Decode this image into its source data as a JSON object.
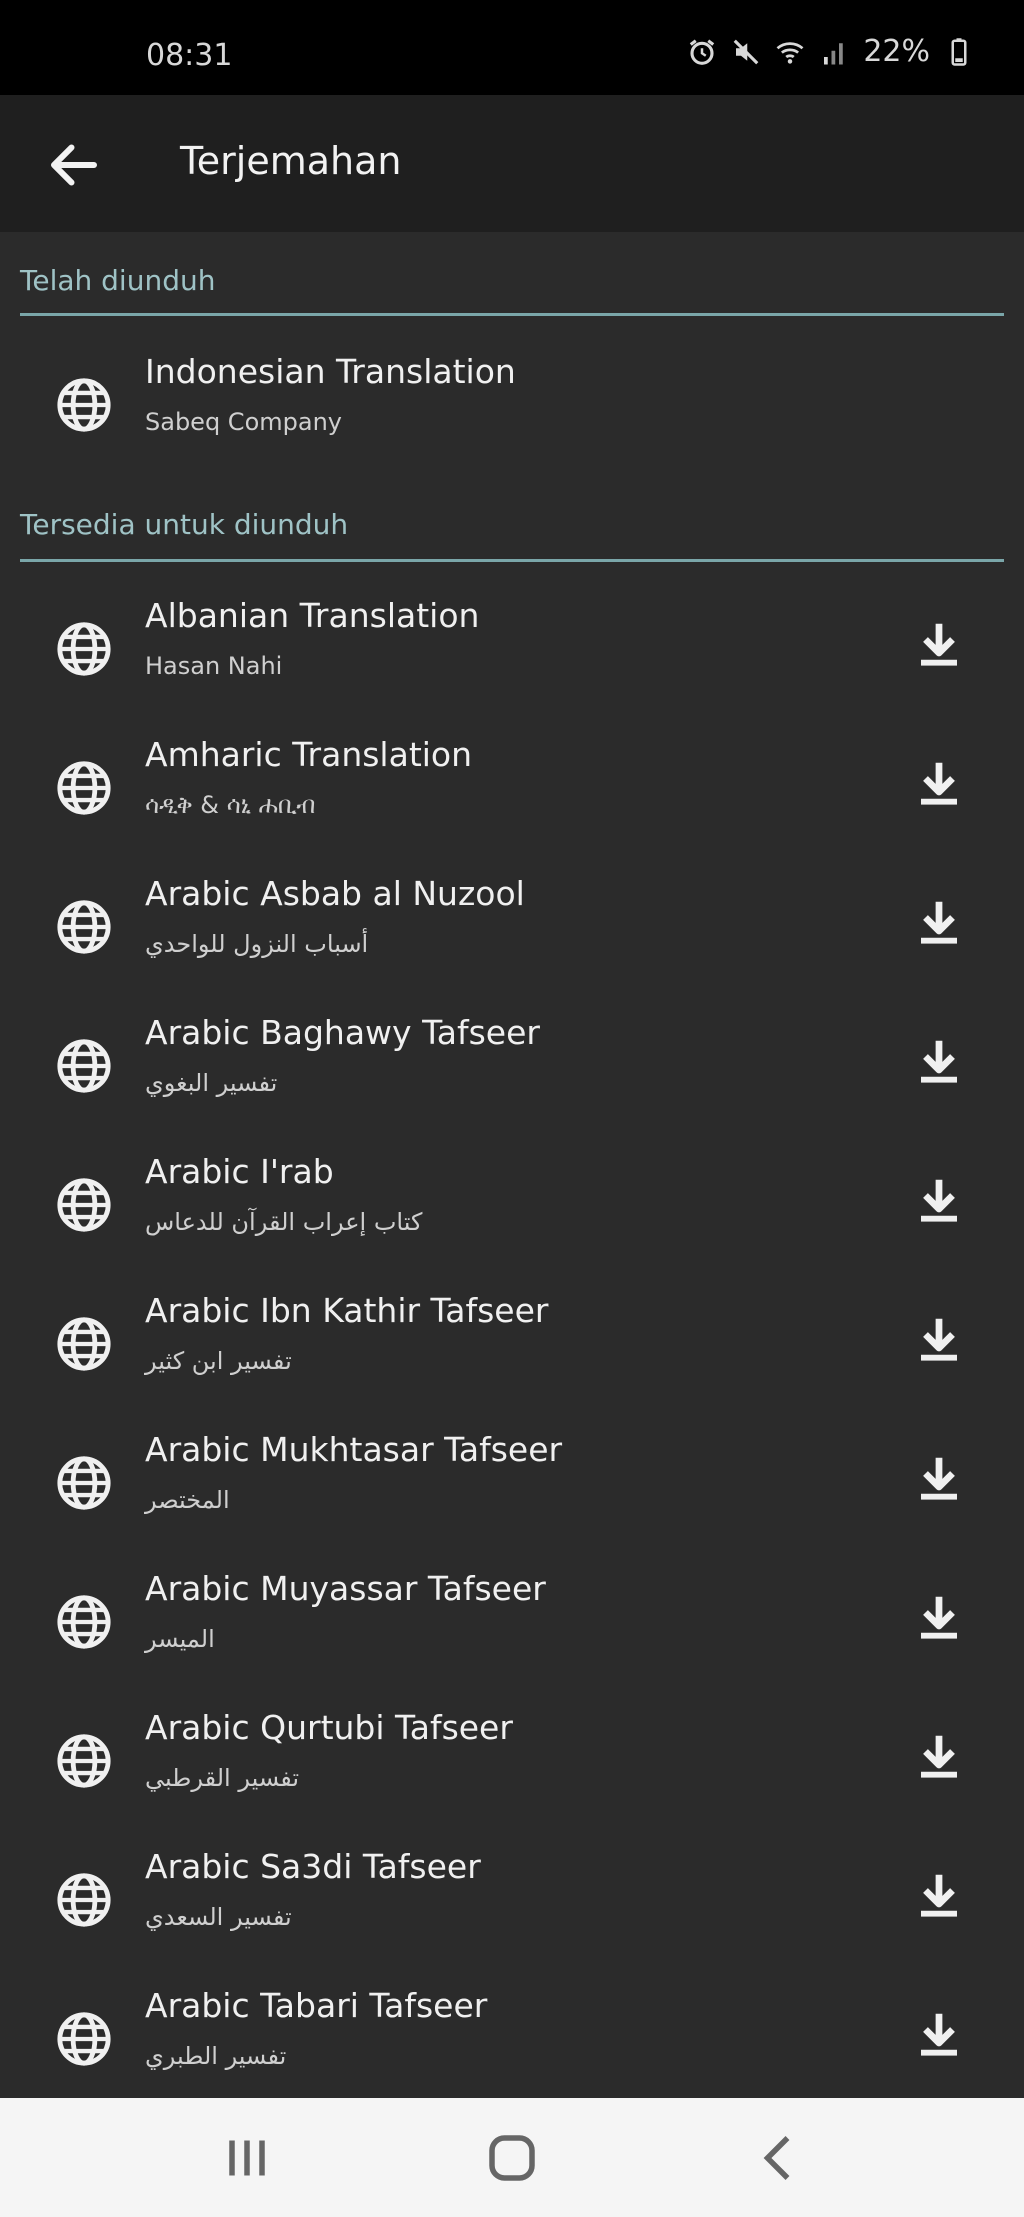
{
  "status_bar": {
    "time": "08:31",
    "battery": "22%",
    "icons": [
      "alarm-icon",
      "mute-icon",
      "wifi-icon",
      "signal-icon",
      "battery-icon"
    ]
  },
  "app_bar": {
    "title": "Terjemahan",
    "back_icon": "arrow-left-icon"
  },
  "downloaded": {
    "header": "Telah diunduh",
    "items": [
      {
        "name": "Indonesian Translation",
        "author": "Sabeq Company"
      }
    ]
  },
  "available": {
    "header": "Tersedia untuk diunduh",
    "items": [
      {
        "name": "Albanian Translation",
        "author": "Hasan Nahi"
      },
      {
        "name": "Amharic Translation",
        "author": "ሳዲቅ & ሳኒ ሐቢብ"
      },
      {
        "name": "Arabic Asbab al Nuzool",
        "author": "أسباب النزول للواحدي"
      },
      {
        "name": "Arabic Baghawy Tafseer",
        "author": "تفسير البغوي"
      },
      {
        "name": "Arabic I'rab",
        "author": "كتاب إعراب القرآن للدعاس"
      },
      {
        "name": "Arabic Ibn Kathir Tafseer",
        "author": "تفسير ابن كثير"
      },
      {
        "name": "Arabic Mukhtasar Tafseer",
        "author": "المختصر"
      },
      {
        "name": "Arabic Muyassar Tafseer",
        "author": "الميسر"
      },
      {
        "name": "Arabic Qurtubi Tafseer",
        "author": "تفسير القرطبي"
      },
      {
        "name": "Arabic Sa3di Tafseer",
        "author": "تفسير السعدي"
      },
      {
        "name": "Arabic Tabari Tafseer",
        "author": "تفسير الطبري"
      }
    ]
  },
  "nav_bar": {
    "icons": [
      "recent-apps-icon",
      "home-icon",
      "back-icon"
    ]
  },
  "colors": {
    "background": "#2b2b2b",
    "app_bar": "#1f1f1f",
    "section_accent": "#7aa6a9",
    "text": "#f0f0f0"
  }
}
